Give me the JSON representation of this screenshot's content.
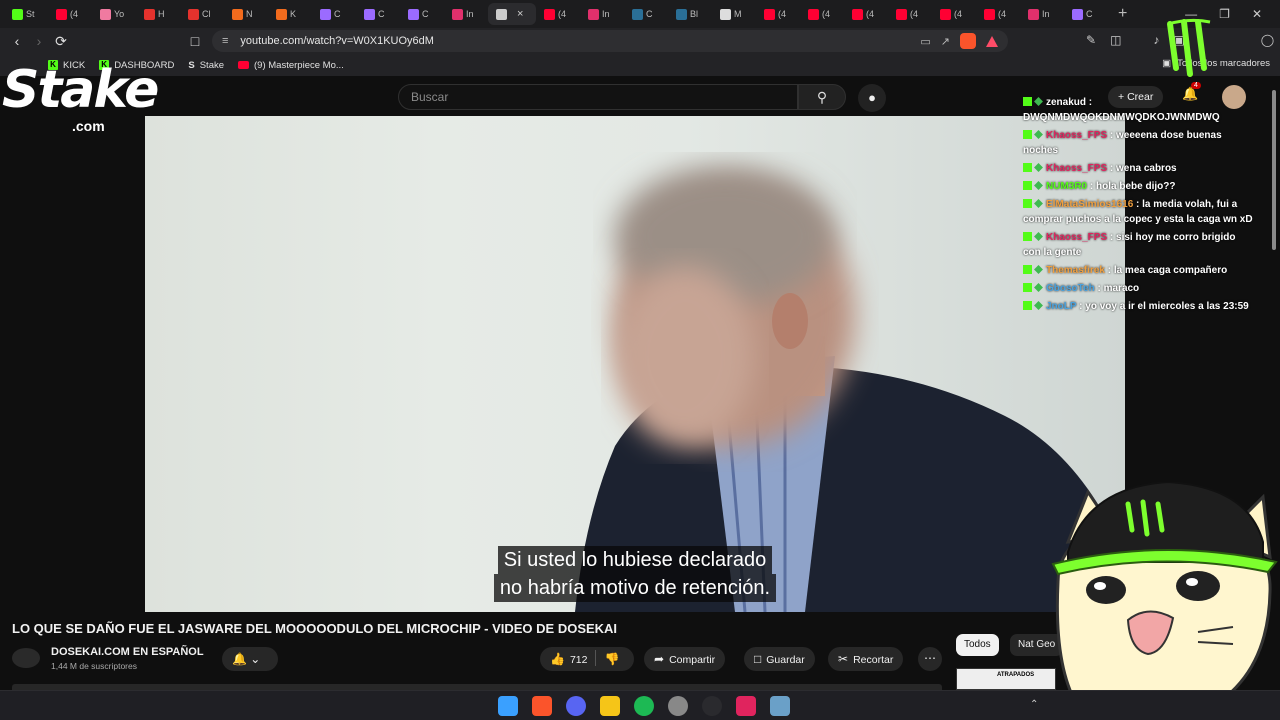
{
  "browser": {
    "tabs": [
      {
        "label": "St",
        "color": "#53fc18"
      },
      {
        "label": "(4",
        "color": "#ff0033"
      },
      {
        "label": "Yo",
        "color": "#f07aa0"
      },
      {
        "label": "H",
        "color": "#e5322d"
      },
      {
        "label": "Cl",
        "color": "#e5322d"
      },
      {
        "label": "N",
        "color": "#f26b1d"
      },
      {
        "label": "K",
        "color": "#f26b1d"
      },
      {
        "label": "C",
        "color": "#9b6bff"
      },
      {
        "label": "C",
        "color": "#9b6bff"
      },
      {
        "label": "C",
        "color": "#9b6bff"
      },
      {
        "label": "In",
        "color": "#e1306c"
      },
      {
        "label": "",
        "color": "#cccccc",
        "active": true
      },
      {
        "label": "(4",
        "color": "#ff0033"
      },
      {
        "label": "In",
        "color": "#e1306c"
      },
      {
        "label": "C",
        "color": "#2a6f97"
      },
      {
        "label": "Bl",
        "color": "#2a6f97"
      },
      {
        "label": "M",
        "color": "#dddddd"
      },
      {
        "label": "(4",
        "color": "#ff0033"
      },
      {
        "label": "(4",
        "color": "#ff0033"
      },
      {
        "label": "(4",
        "color": "#ff0033"
      },
      {
        "label": "(4",
        "color": "#ff0033"
      },
      {
        "label": "(4",
        "color": "#ff0033"
      },
      {
        "label": "(4",
        "color": "#ff0033"
      },
      {
        "label": "In",
        "color": "#e1306c"
      },
      {
        "label": "C",
        "color": "#9b6bff"
      }
    ],
    "new_tab": "+",
    "url": "youtube.com/watch?v=W0X1KUOy6dM",
    "bookmarks": [
      {
        "label": "KICK",
        "icon": "kick"
      },
      {
        "label": "DASHBOARD",
        "icon": "kick"
      },
      {
        "label": "Stake",
        "icon": "stake"
      },
      {
        "label": "(9) Masterpiece Mo...",
        "icon": "youtube"
      }
    ],
    "all_bookmarks": "Todos los marcadores"
  },
  "youtube": {
    "search_placeholder": "Buscar",
    "create_label": "Crear",
    "notif_count": "4",
    "video": {
      "subtitle_line1": "Si usted lo hubiese declarado",
      "subtitle_line2": "no habría motivo de retención."
    },
    "title": "LO QUE SE DAÑO FUE EL JASWARE DEL MOOOOODULO DEL MICROCHIP - VIDEO DE DOSEKAI",
    "channel_name": "DOSEKAI.COM EN ESPAÑOL",
    "channel_subs": "1,44 M de suscriptores",
    "likes": "712",
    "share_label": "Compartir",
    "save_label": "Guardar",
    "clip_label": "Recortar",
    "chips": [
      "Todos",
      "Nat Geo"
    ],
    "thumb_text": "ATRAPADOS"
  },
  "overlay": {
    "stake_word": "Stake",
    "stake_com": ".com",
    "chat": [
      {
        "user": "zenakud",
        "user_color": "#ffffff",
        "message": "DWQNMDWQOKDNMWQDKOJWNMDWQ"
      },
      {
        "user": "Khaoss_FPS",
        "user_color": "#e0245e",
        "message": "weeeena dose buenas noches"
      },
      {
        "user": "Khaoss_FPS",
        "user_color": "#e0245e",
        "message": "wena cabros"
      },
      {
        "user": "NUM3R0",
        "user_color": "#53fc18",
        "message": "hola bebe dijo??"
      },
      {
        "user": "ElMataSimios1616",
        "user_color": "#f0a040",
        "message": "la media volah, fui a comprar puchos a la copec y esta la caga wn xD"
      },
      {
        "user": "Khaoss_FPS",
        "user_color": "#e0245e",
        "message": "sisi hoy me corro brigido con la gente"
      },
      {
        "user": "Themasfirek",
        "user_color": "#f0a040",
        "message": "la mea caga compañero"
      },
      {
        "user": "GbosoTeh",
        "user_color": "#4aa3df",
        "message": "maraco"
      },
      {
        "user": "JnoLP",
        "user_color": "#4aa3df",
        "message": "yo voy a ir el miercoles a las 23:59"
      }
    ]
  }
}
